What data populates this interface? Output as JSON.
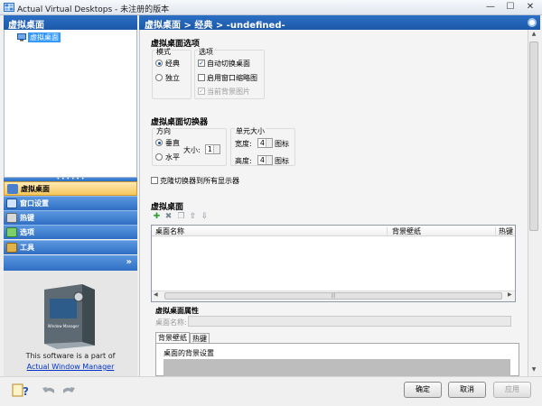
{
  "window": {
    "title": "Actual Virtual Desktops - 未注册的版本",
    "minimize": "—",
    "maximize": "☐",
    "close": "✕"
  },
  "left_panel": {
    "header": "虚拟桌面",
    "tree_item": "虚拟桌面",
    "nav_items": [
      {
        "label": "虚拟桌面",
        "icon": "desktop-icon"
      },
      {
        "label": "窗口设置",
        "icon": "window-icon"
      },
      {
        "label": "热键",
        "icon": "keyboard-icon"
      },
      {
        "label": "选项",
        "icon": "options-icon"
      },
      {
        "label": "工具",
        "icon": "tools-icon"
      }
    ],
    "more": "»",
    "promo_text": "This software is a part of",
    "promo_link": "Actual Window Manager",
    "promo_box_title": "Window Manager"
  },
  "right_panel": {
    "breadcrumb": "虚拟桌面 > 经典 > -undefined-",
    "options_section": {
      "title": "虚拟桌面选项",
      "mode_group": "模式",
      "mode_classic": "经典",
      "mode_independent": "独立",
      "mode_selected": "经典",
      "options_group": "选项",
      "auto_switch": "自动切换桌面",
      "auto_switch_checked": true,
      "enable_thumbnails": "启用窗口缩略图",
      "enable_thumbnails_checked": false,
      "current_wallpaper": "当前背景图片",
      "current_wallpaper_checked": true
    },
    "switcher_section": {
      "title": "虚拟桌面切换器",
      "direction_group": "方向",
      "vertical": "垂直",
      "horizontal": "水平",
      "direction_selected": "垂直",
      "size_label": "大小:",
      "size_value": "1",
      "cell_size_group": "单元大小",
      "width_label": "宽度:",
      "width_value": "4",
      "width_unit": "图标",
      "height_label": "高度:",
      "height_value": "4",
      "height_unit": "图标",
      "clone_all": "克隆切换器到所有显示器",
      "clone_all_checked": false
    },
    "desktops_section": {
      "title": "虚拟桌面",
      "columns": [
        "桌面名称",
        "背景壁纸",
        "热键"
      ],
      "rows": []
    },
    "properties": {
      "title": "虚拟桌面属性",
      "name_label": "桌面名称:",
      "name_value": "",
      "tabs": [
        "背景壁纸",
        "热键"
      ],
      "active_tab": "背景壁纸",
      "wallpaper_settings": "桌面的背景设置"
    }
  },
  "buttons": {
    "ok": "确定",
    "cancel": "取消",
    "apply": "应用"
  }
}
